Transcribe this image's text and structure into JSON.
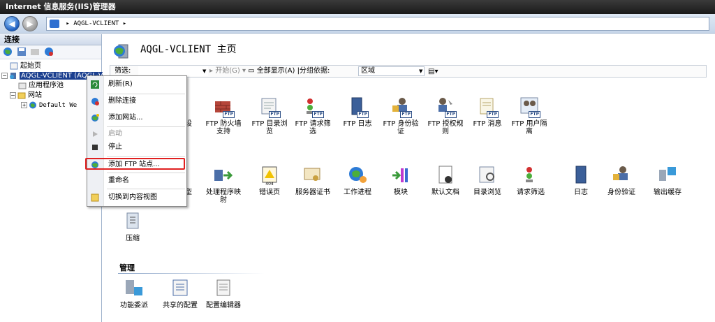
{
  "window": {
    "title": "Internet 信息服务(IIS)管理器"
  },
  "nav": {
    "breadcrumb": "AQGL-VCLIENT",
    "sep": "▸"
  },
  "connections": {
    "header": "连接",
    "tree": {
      "start_page": "起始页",
      "server": "AQGL-VCLIENT (AQGL-V",
      "app_pools": "应用程序池",
      "sites": "网站",
      "default_site": "Default We"
    }
  },
  "main": {
    "title": "AQGL-VCLIENT 主页",
    "filter": {
      "label": "筛选:",
      "start": "开始(G)",
      "show_all": "全部显示(A)",
      "groupby_label": "|分组依据:",
      "groupby_value": "区域"
    },
    "ftp_features": [
      {
        "label": "设"
      },
      {
        "label": "FTP 防火墙\n支持"
      },
      {
        "label": "FTP 目录浏\n览"
      },
      {
        "label": "FTP 请求筛\n选"
      },
      {
        "label": "FTP 日志"
      },
      {
        "label": "FTP 身份验\n证"
      },
      {
        "label": "FTP 授权规\n则"
      },
      {
        "label": "FTP 消息"
      },
      {
        "label": "FTP 用户隔\n离"
      }
    ],
    "iis_features": [
      {
        "label": "型"
      },
      {
        "label": "处理程序映\n射"
      },
      {
        "label": "错误页"
      },
      {
        "label": "服务器证书"
      },
      {
        "label": "工作进程"
      },
      {
        "label": "模块"
      },
      {
        "label": "默认文档"
      },
      {
        "label": "目录浏览"
      },
      {
        "label": "请求筛选"
      },
      {
        "label": "日志"
      },
      {
        "label": "身份验证"
      },
      {
        "label": "输出缓存"
      },
      {
        "label": "压缩"
      }
    ],
    "management_title": "管理",
    "management": [
      {
        "label": "功能委派"
      },
      {
        "label": "共享的配置"
      },
      {
        "label": "配置编辑器"
      }
    ]
  },
  "context_menu": {
    "items": [
      {
        "label": "刷新(R)"
      },
      {
        "label": "删除连接"
      },
      {
        "label": "添加网站..."
      },
      {
        "label": "启动"
      },
      {
        "label": "停止"
      },
      {
        "label": "添加 FTP 站点..."
      },
      {
        "label": "重命名"
      },
      {
        "label": "切换到内容视图"
      }
    ]
  },
  "colors": {
    "highlight": "#e02020",
    "selection": "#1b3f8f",
    "ftp_tag": "#2b4d85"
  }
}
